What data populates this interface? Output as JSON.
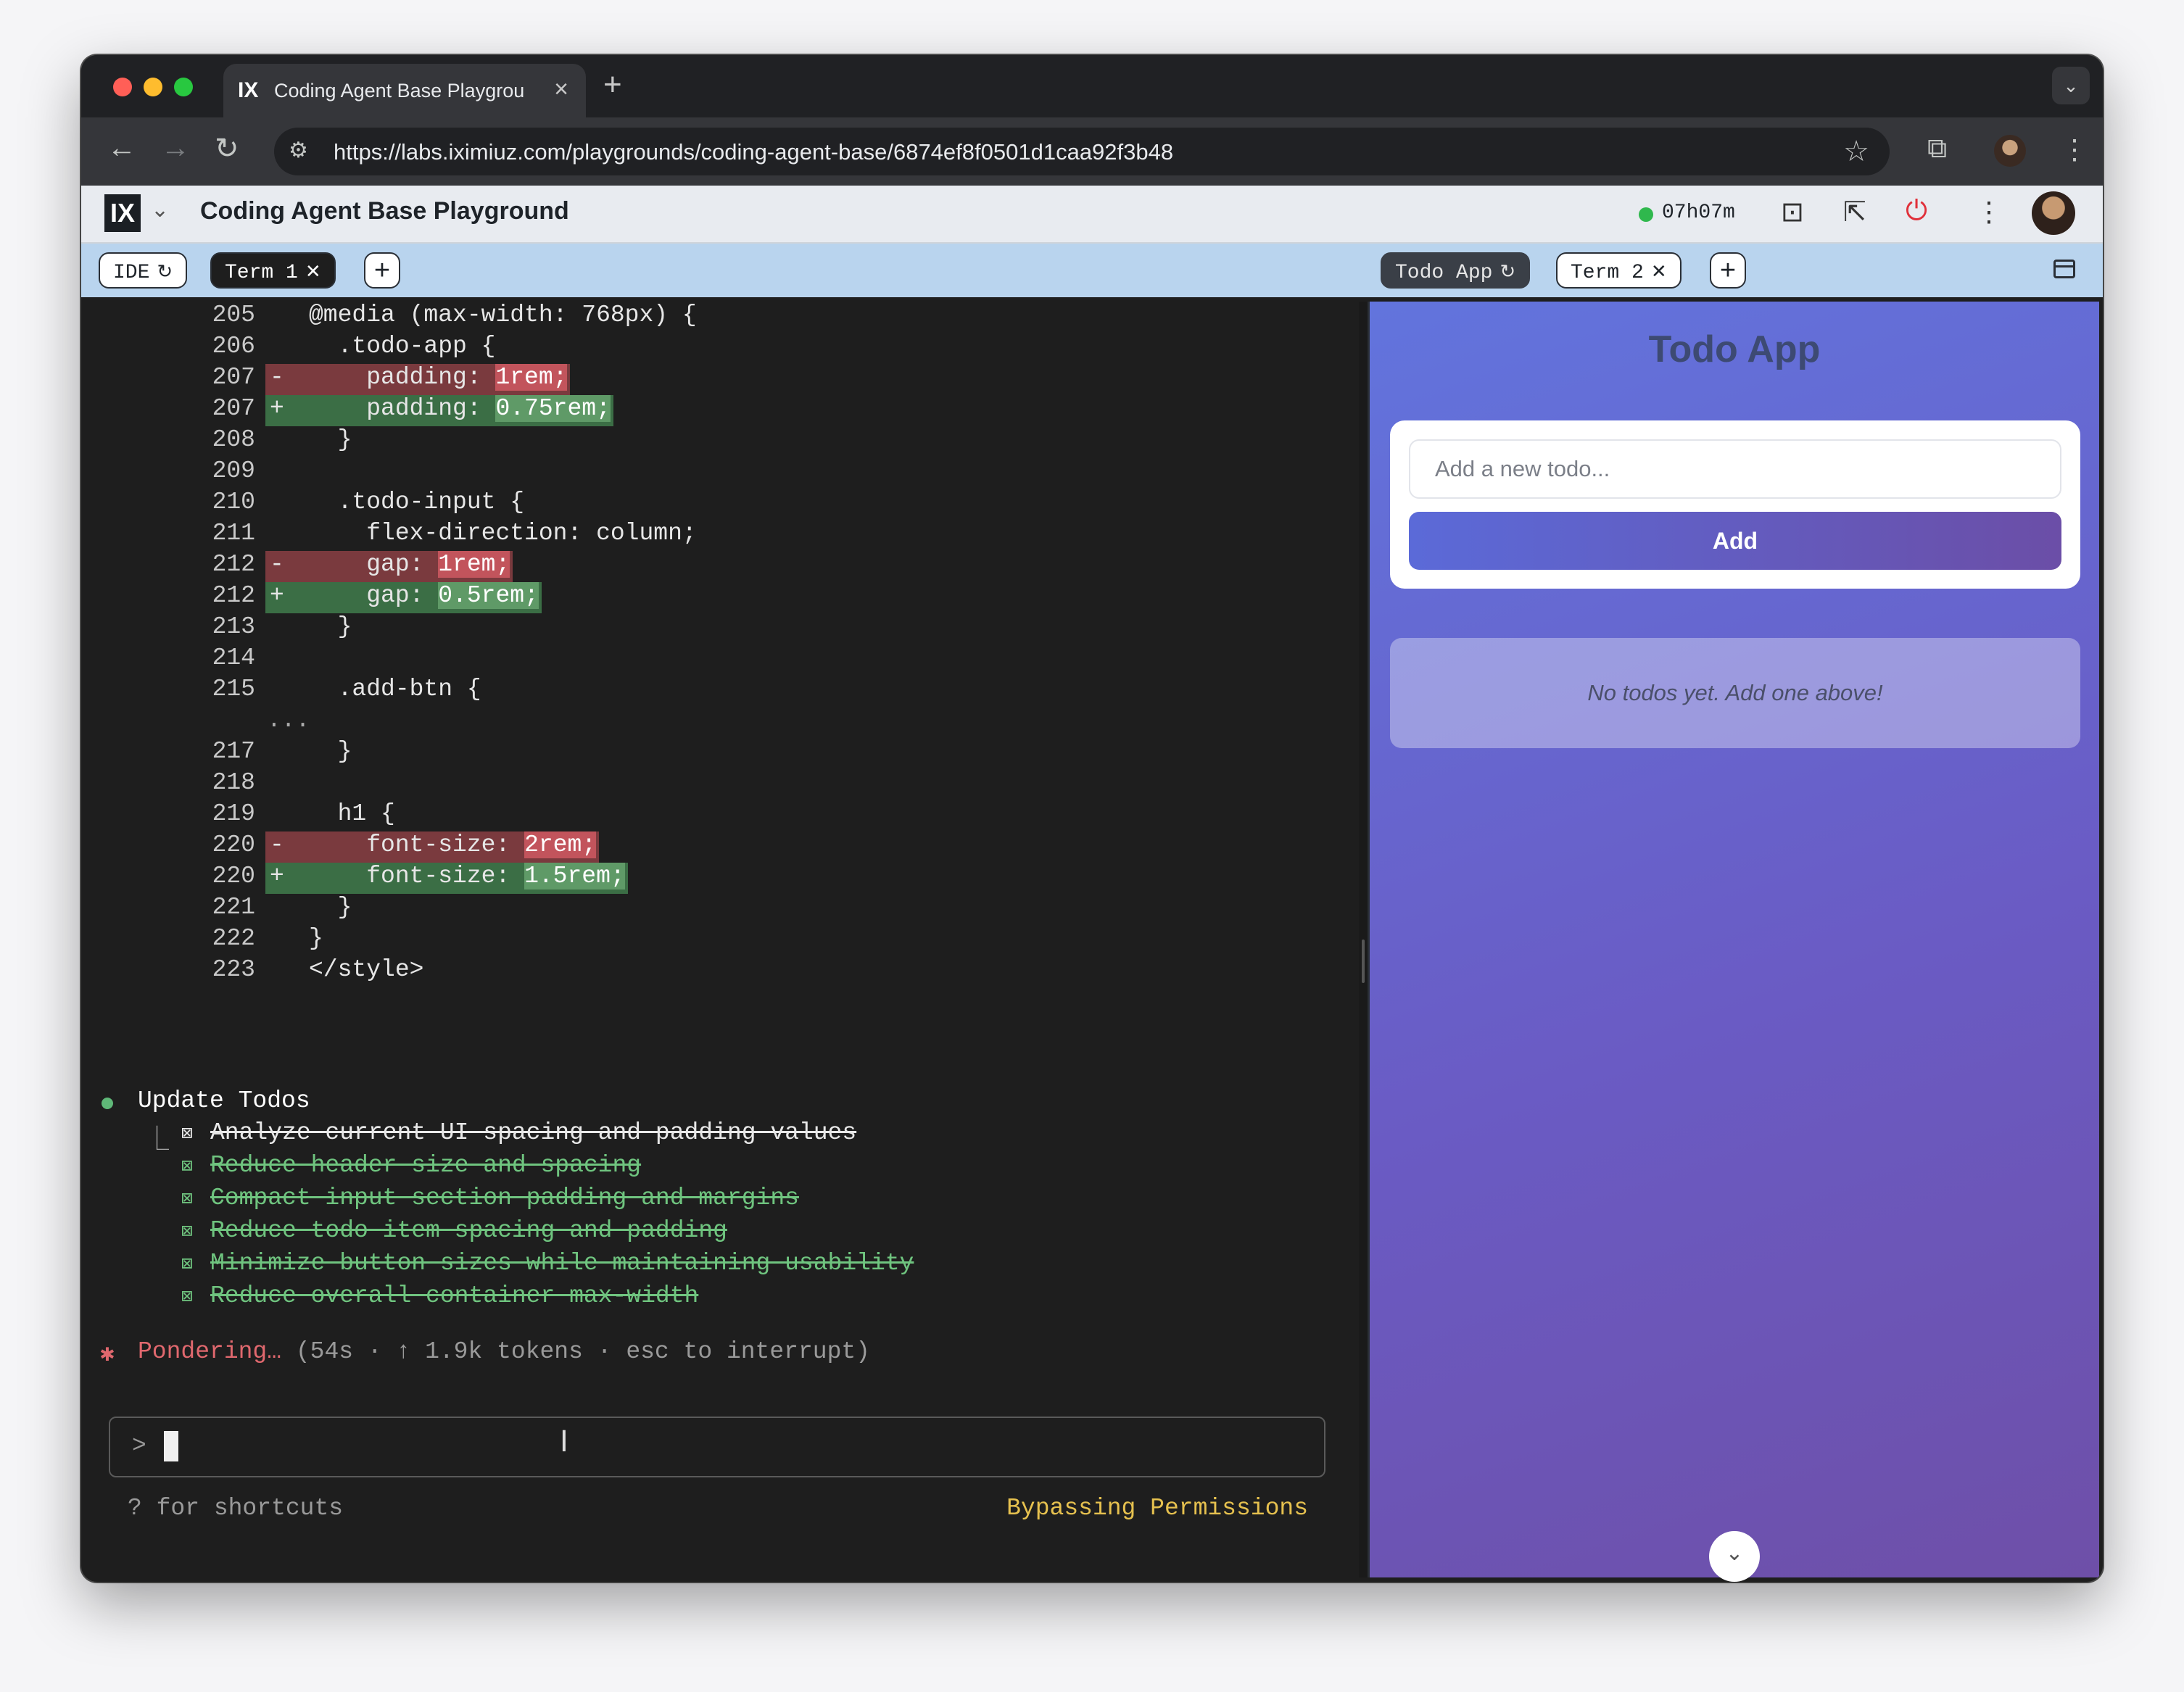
{
  "browser": {
    "tab_favicon": "IX",
    "tab_title": "Coding Agent Base Playgrou",
    "tab_close": "×",
    "new_tab": "+",
    "tab_menu": "⌄",
    "url": "https://labs.iximiuz.com/playgrounds/coding-agent-base/6874ef8f0501d1caa92f3b48",
    "back": "←",
    "forward": "→",
    "reload": "↻",
    "site_settings": "⚙",
    "bookmark": "☆",
    "extensions": "⧉",
    "menu": "⋮"
  },
  "app_header": {
    "logo": "IX",
    "logo_caret": "⌄",
    "title": "Coding Agent Base Playground",
    "timer": "07h07m",
    "status_color": "#2fb84d",
    "icons": {
      "terminal": "⊡",
      "open_external": "⇱",
      "power": "⏻",
      "more": "⋮"
    }
  },
  "left_tabs": [
    {
      "label": "IDE",
      "symbol": "↻"
    },
    {
      "label": "Term 1",
      "symbol": "✕"
    }
  ],
  "right_tabs": [
    {
      "label": "Todo App",
      "symbol": "↻"
    },
    {
      "label": "Term 2",
      "symbol": "✕"
    }
  ],
  "plus": "+",
  "terminal": {
    "code": [
      {
        "ln": "205",
        "mark": "",
        "type": "ctx",
        "pre": "@media (max-width: 768px) {",
        "hl": "",
        "post": ""
      },
      {
        "ln": "206",
        "mark": "",
        "type": "ctx",
        "pre": "  .todo-app {",
        "hl": "",
        "post": ""
      },
      {
        "ln": "207",
        "mark": "-",
        "type": "del",
        "pre": "    padding: ",
        "hl": "1rem;",
        "post": ""
      },
      {
        "ln": "207",
        "mark": "+",
        "type": "add",
        "pre": "    padding: ",
        "hl": "0.75rem;",
        "post": ""
      },
      {
        "ln": "208",
        "mark": "",
        "type": "ctx",
        "pre": "  }",
        "hl": "",
        "post": ""
      },
      {
        "ln": "209",
        "mark": "",
        "type": "ctx",
        "pre": "",
        "hl": "",
        "post": ""
      },
      {
        "ln": "210",
        "mark": "",
        "type": "ctx",
        "pre": "  .todo-input {",
        "hl": "",
        "post": ""
      },
      {
        "ln": "211",
        "mark": "",
        "type": "ctx",
        "pre": "    flex-direction: column;",
        "hl": "",
        "post": ""
      },
      {
        "ln": "212",
        "mark": "-",
        "type": "del",
        "pre": "    gap: ",
        "hl": "1rem;",
        "post": ""
      },
      {
        "ln": "212",
        "mark": "+",
        "type": "add",
        "pre": "    gap: ",
        "hl": "0.5rem;",
        "post": ""
      },
      {
        "ln": "213",
        "mark": "",
        "type": "ctx",
        "pre": "  }",
        "hl": "",
        "post": ""
      },
      {
        "ln": "214",
        "mark": "",
        "type": "ctx",
        "pre": "",
        "hl": "",
        "post": ""
      },
      {
        "ln": "215",
        "mark": "",
        "type": "ctx",
        "pre": "  .add-btn {",
        "hl": "",
        "post": ""
      },
      {
        "ln": "...",
        "mark": "",
        "type": "dots",
        "pre": "",
        "hl": "",
        "post": ""
      },
      {
        "ln": "217",
        "mark": "",
        "type": "ctx",
        "pre": "  }",
        "hl": "",
        "post": ""
      },
      {
        "ln": "218",
        "mark": "",
        "type": "ctx",
        "pre": "",
        "hl": "",
        "post": ""
      },
      {
        "ln": "219",
        "mark": "",
        "type": "ctx",
        "pre": "  h1 {",
        "hl": "",
        "post": ""
      },
      {
        "ln": "220",
        "mark": "-",
        "type": "del",
        "pre": "    font-size: ",
        "hl": "2rem;",
        "post": ""
      },
      {
        "ln": "220",
        "mark": "+",
        "type": "add",
        "pre": "    font-size: ",
        "hl": "1.5rem;",
        "post": ""
      },
      {
        "ln": "221",
        "mark": "",
        "type": "ctx",
        "pre": "  }",
        "hl": "",
        "post": ""
      },
      {
        "ln": "222",
        "mark": "",
        "type": "ctx",
        "pre": "}",
        "hl": "",
        "post": ""
      },
      {
        "ln": "223",
        "mark": "",
        "type": "ctx",
        "pre": "</style>",
        "hl": "",
        "post": ""
      }
    ],
    "todos_heading": "Update Todos",
    "tree_glyph": "⎿",
    "checkbox": "⊠",
    "todos": [
      "Analyze current UI spacing and padding values",
      "Reduce header size and spacing",
      "Compact input section padding and margins",
      "Reduce todo item spacing and padding",
      "Minimize button sizes while maintaining usability",
      "Reduce overall container max-width"
    ],
    "ponder_star": "✱",
    "ponder_label": "Pondering…",
    "ponder_meta": " (54s · ↑ 1.9k tokens · esc to interrupt)",
    "prompt": ">",
    "shortcuts": "? for shortcuts",
    "bypass": "Bypassing Permissions"
  },
  "todo_app": {
    "title": "Todo App",
    "input_placeholder": "Add a new todo...",
    "add_label": "Add",
    "empty_message": "No todos yet. Add one above!",
    "scroll_icon": "⌄"
  }
}
